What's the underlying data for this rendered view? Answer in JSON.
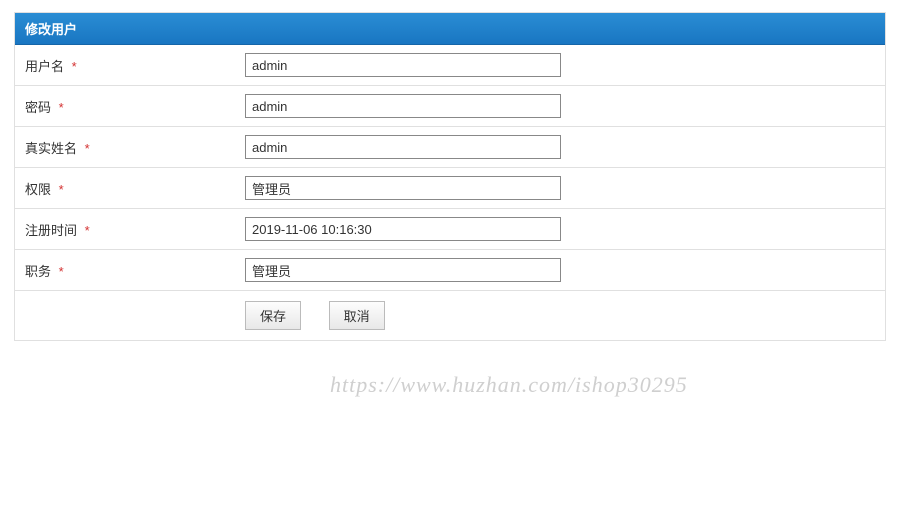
{
  "panel": {
    "title": "修改用户"
  },
  "form": {
    "username": {
      "label": "用户名",
      "value": "admin"
    },
    "password": {
      "label": "密码",
      "value": "admin"
    },
    "realname": {
      "label": "真实姓名",
      "value": "admin"
    },
    "role": {
      "label": "权限",
      "value": "管理员"
    },
    "regtime": {
      "label": "注册时间",
      "value": "2019-11-06 10:16:30"
    },
    "position": {
      "label": "职务",
      "value": "管理员"
    }
  },
  "buttons": {
    "save": "保存",
    "cancel": "取消"
  },
  "required_marker": "*",
  "watermark": "https://www.huzhan.com/ishop30295"
}
